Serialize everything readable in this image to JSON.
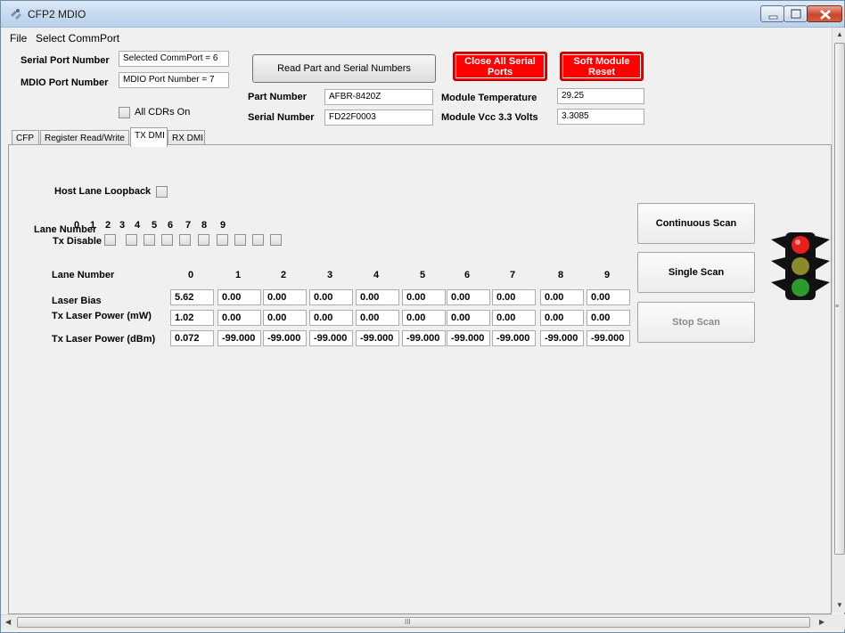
{
  "window": {
    "title": "CFP2 MDIO"
  },
  "menu": [
    "File",
    "Select CommPort"
  ],
  "header": {
    "serial_port_label": "Serial Port Number",
    "serial_port_value": "Selected CommPort = 6",
    "mdio_port_label": "MDIO Port Number",
    "mdio_port_value": "MDIO Port Number = 7",
    "all_cdrs_label": "All CDRs On",
    "read_button": "Read Part and Serial Numbers",
    "close_ports_button": "Close All Serial Ports",
    "soft_reset_button": "Soft Module Reset",
    "part_number_label": "Part Number",
    "part_number_value": "AFBR-8420Z",
    "serial_number_label": "Serial Number",
    "serial_number_value": "FD22F0003",
    "module_temp_label": "Module Temperature",
    "module_temp_value": "29.25",
    "module_vcc_label": "Module Vcc 3.3 Volts",
    "module_vcc_value": "3.3085"
  },
  "tabs": [
    "CFP",
    "Register Read/Write",
    "TX DMI",
    "RX DMI"
  ],
  "active_tab": "TX DMI",
  "txdmi": {
    "host_loopback_label": "Host Lane Loopback",
    "lane_number_label": "Lane Number",
    "tx_disable_label": "Tx Disable",
    "lane_digits": [
      "0",
      "1",
      "2",
      "3",
      "4",
      "5",
      "6",
      "7",
      "8",
      "9"
    ],
    "table_lane_label": "Lane Number",
    "columns": [
      "0",
      "1",
      "2",
      "3",
      "4",
      "5",
      "6",
      "7",
      "8",
      "9"
    ],
    "rows": [
      {
        "label": "Laser Bias",
        "values": [
          "5.62",
          "0.00",
          "0.00",
          "0.00",
          "0.00",
          "0.00",
          "0.00",
          "0.00",
          "0.00",
          "0.00"
        ]
      },
      {
        "label": "Tx Laser Power (mW)",
        "values": [
          "1.02",
          "0.00",
          "0.00",
          "0.00",
          "0.00",
          "0.00",
          "0.00",
          "0.00",
          "0.00",
          "0.00"
        ]
      },
      {
        "label": "Tx Laser Power (dBm)",
        "values": [
          "0.072",
          "-99.000",
          "-99.000",
          "-99.000",
          "-99.000",
          "-99.000",
          "-99.000",
          "-99.000",
          "-99.000",
          "-99.000"
        ]
      }
    ],
    "continuous_scan": "Continuous Scan",
    "single_scan": "Single Scan",
    "stop_scan": "Stop Scan"
  },
  "scrollbar": {
    "h_thumb_grip": "III"
  },
  "colors": {
    "red_button": "#ff0000",
    "traffic_red": "#e82020",
    "traffic_yellow": "#8a8a2a",
    "traffic_green": "#2e9a2e"
  },
  "icons": [
    "app-icon",
    "minimize-icon",
    "maximize-icon",
    "close-icon",
    "traffic-light-icon"
  ]
}
